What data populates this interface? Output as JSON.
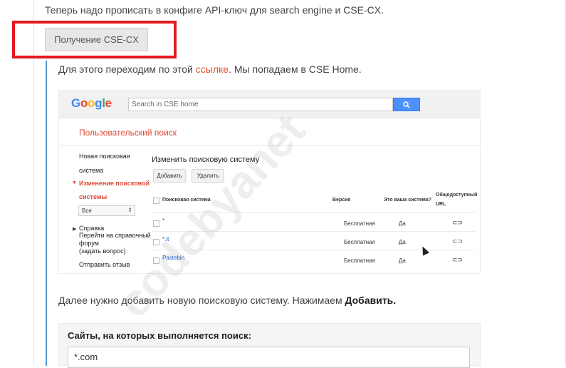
{
  "article": {
    "intro": "Теперь надо прописать в конфиге API-ключ для search engine и CSE-CX.",
    "spoiler_button": "Получение CSE-CX",
    "text1_before": "Для этого переходим по этой ",
    "text1_link": "ссылке",
    "text1_after": ". Мы попадаем в CSE Home.",
    "text2_plain": "Далее нужно добавить новую поисковую систему. Нажимаем ",
    "text2_bold": "Добавить."
  },
  "screenshot": {
    "logo": [
      "G",
      "o",
      "o",
      "g",
      "l",
      "e"
    ],
    "search_placeholder": "Search in CSE home",
    "search_button_icon": "search-icon",
    "section_title": "Пользовательский поиск",
    "sidebar": {
      "new_line1": "Новая поисковая",
      "new_line2": "система",
      "edit_line1": "Изменение поисковой",
      "edit_line2": "системы",
      "select_value": "Все",
      "help": "Справка",
      "forum_line1": "Перейти на справочный",
      "forum_line2": "форум",
      "forum_line3": "(задать вопрос)",
      "feedback": "Отправить отзыв"
    },
    "main_title": "Изменить поисковую систему",
    "add_button": "Добавить",
    "delete_button": "Удалить",
    "columns": {
      "engine": "Поисковая система",
      "version": "Версия",
      "yours": "Это ваша система?",
      "public1": "Общедоступный",
      "public2": "URL"
    },
    "rows": [
      {
        "name": "*",
        "version": "Бесплатная",
        "yours": "Да"
      },
      {
        "name": "*.it",
        "version": "Бесплатная",
        "yours": "Да"
      },
      {
        "name": "Pastebin",
        "version": "Бесплатная",
        "yours": "Да"
      }
    ],
    "link_icon": "link-icon"
  },
  "watermark": "codebyanet",
  "form": {
    "label": "Сайты, на которых выполняется поиск:",
    "value": "*.com"
  },
  "colors": {
    "highlight_border": "#e2191f",
    "link": "#e6522b",
    "accent_rule": "#5b9bd5",
    "google_blue": "#4285f4",
    "google_red": "#ea4335",
    "google_yellow": "#fbbc05",
    "google_green": "#34a853",
    "cse_red": "#dd4b39"
  }
}
